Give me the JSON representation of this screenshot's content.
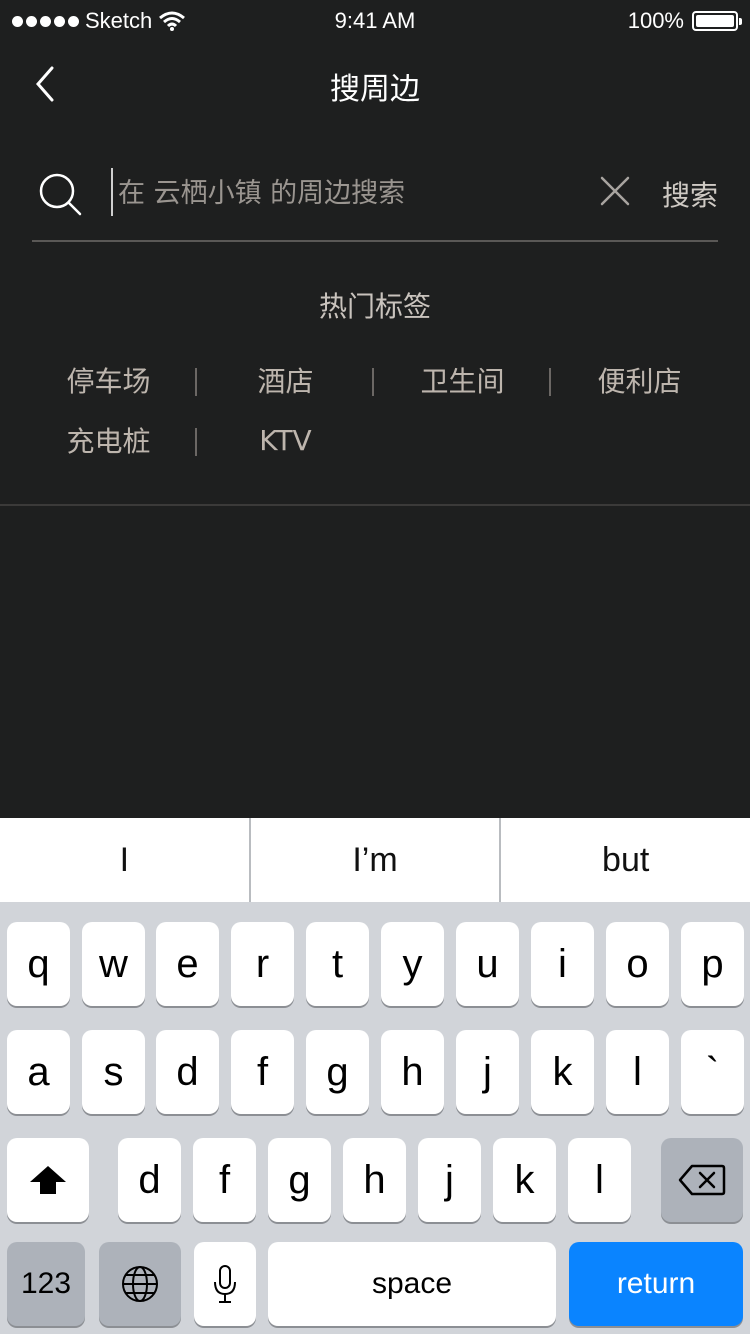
{
  "status_bar": {
    "carrier": "Sketch",
    "time": "9:41 AM",
    "battery": "100%",
    "battery_level": 1.0
  },
  "nav": {
    "title": "搜周边"
  },
  "search": {
    "placeholder": "在 云栖小镇 的周边搜索",
    "value": "",
    "button_label": "搜索"
  },
  "hot_tags": {
    "title": "热门标签",
    "rows": [
      [
        "停车场",
        "酒店",
        "卫生间",
        "便利店"
      ],
      [
        "充电桩",
        "KTV"
      ]
    ]
  },
  "keyboard": {
    "suggestions": [
      "I",
      "I’m",
      "but"
    ],
    "row1": [
      "q",
      "w",
      "e",
      "r",
      "t",
      "y",
      "u",
      "i",
      "o",
      "p"
    ],
    "row2": [
      "a",
      "s",
      "d",
      "f",
      "g",
      "h",
      "j",
      "k",
      "l",
      "`"
    ],
    "row3": [
      "d",
      "f",
      "g",
      "h",
      "j",
      "k",
      "l"
    ],
    "numbers_label": "123",
    "space_label": "space",
    "return_label": "return"
  },
  "colors": {
    "background": "#1e1f1f",
    "return_key": "#0a84ff",
    "keyboard_bg": "#d1d4d9"
  }
}
